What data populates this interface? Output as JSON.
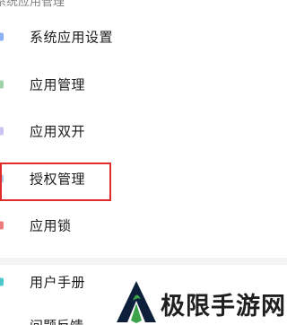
{
  "header": {
    "clipped_title": "系统应用管理"
  },
  "menu": {
    "items": [
      {
        "label": "系统应用设置",
        "icon": "settings-icon"
      },
      {
        "label": "应用管理",
        "icon": "apps-icon"
      },
      {
        "label": "应用双开",
        "icon": "dual-apps-icon"
      },
      {
        "label": "授权管理",
        "icon": "authorization-icon"
      },
      {
        "label": "应用锁",
        "icon": "lock-icon"
      }
    ],
    "secondary_items": [
      {
        "label": "用户手册",
        "icon": "manual-icon"
      },
      {
        "label": "问题反馈",
        "icon": "feedback-icon"
      }
    ]
  },
  "watermark": {
    "text": "极限手游网"
  },
  "colors": {
    "highlight": "#e02b2b",
    "logo_dark": "#0d1f3a",
    "logo_green": "#3da34a"
  }
}
